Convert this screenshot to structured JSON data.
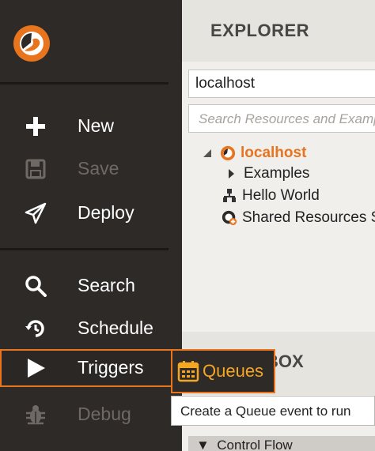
{
  "nav": {
    "items": [
      {
        "label": "New",
        "icon": "plus-icon",
        "disabled": false
      },
      {
        "label": "Save",
        "icon": "save-icon",
        "disabled": true
      },
      {
        "label": "Deploy",
        "icon": "paper-plane-icon",
        "disabled": false
      },
      {
        "label": "Search",
        "icon": "search-icon",
        "disabled": false
      },
      {
        "label": "Schedule",
        "icon": "history-icon",
        "disabled": false
      },
      {
        "label": "Triggers",
        "icon": "play-icon",
        "disabled": false,
        "active": true
      },
      {
        "label": "Debug",
        "icon": "bug-icon",
        "disabled": true
      }
    ],
    "accent": "#e8741e"
  },
  "explorer": {
    "title": "EXPLORER",
    "host_value": "localhost",
    "search_placeholder": "Search Resources and Examples",
    "tree": {
      "root": "localhost",
      "children": [
        "Examples",
        "Hello World",
        "Shared Resources Se"
      ]
    }
  },
  "toolbox": {
    "title_visible": "BOX",
    "first_group": "Control Flow"
  },
  "flyout": {
    "label": "Queues",
    "tooltip": "Create a Queue event to run"
  }
}
